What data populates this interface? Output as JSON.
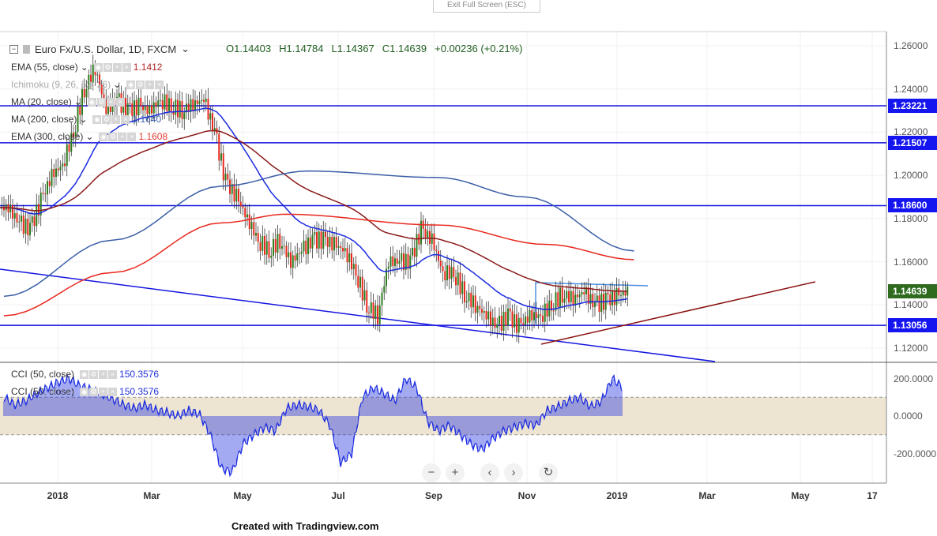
{
  "topbar": {
    "exit_label": "Exit Full Screen (ESC)"
  },
  "header": {
    "symbol": "Euro Fx/U.S. Dollar, 1D, FXCM",
    "open": "O1.14403",
    "high": "H1.14784",
    "low": "L1.14367",
    "close": "C1.14639",
    "change": "+0.00236 (+0.21%)"
  },
  "indicators": [
    {
      "label": "EMA (55, close)",
      "value": "1.1412",
      "color": "#b22222"
    },
    {
      "label": "Ichimoku (9, 26, 52, 26)",
      "value": "",
      "color": "#aaaaaa"
    },
    {
      "label": "MA (20, close)",
      "value": "",
      "color": "#1e3fd8"
    },
    {
      "label": "MA (200, close)",
      "value": "1.1640",
      "color": "#3b5fa8"
    },
    {
      "label": "EMA (300, close)",
      "value": "1.1608",
      "color": "#e53935"
    }
  ],
  "cci_legends": [
    {
      "label": "CCI (50, close)",
      "value": "150.3576"
    },
    {
      "label": "CCI (50, close)",
      "value": "150.3576"
    }
  ],
  "controls": {
    "zoom_out": "−",
    "zoom_in": "+",
    "back": "‹",
    "forward": "›",
    "reset": "↻"
  },
  "footer": {
    "credit": "Created with Tradingview.com"
  },
  "chart_data": {
    "type": "candlestick",
    "price_ticks": [
      "1.26000",
      "1.24000",
      "1.22000",
      "1.20000",
      "1.18000",
      "1.16000",
      "1.14000",
      "1.12000"
    ],
    "price_tick_values": [
      1.26,
      1.24,
      1.22,
      1.2,
      1.18,
      1.16,
      1.14,
      1.12
    ],
    "cci_ticks": [
      "200.0000",
      "0.0000",
      "-200.0000"
    ],
    "cci_tick_values": [
      200,
      0,
      -200
    ],
    "time_labels": [
      "2018",
      "Mar",
      "May",
      "Jul",
      "Sep",
      "Nov",
      "2019",
      "Mar",
      "May",
      "17"
    ],
    "horizontal_levels": [
      {
        "value": 1.23221,
        "label": "1.23221"
      },
      {
        "value": 1.21507,
        "label": "1.21507"
      },
      {
        "value": 1.186,
        "label": "1.18600"
      },
      {
        "value": 1.13056,
        "label": "1.13056"
      }
    ],
    "last_price": {
      "value": 1.14639,
      "label": "1.14639",
      "color": "#2e6b1f"
    },
    "weekly_closes": [
      1.185,
      1.178,
      1.175,
      1.188,
      1.2,
      1.205,
      1.22,
      1.24,
      1.25,
      1.23,
      1.235,
      1.23,
      1.232,
      1.23,
      1.235,
      1.232,
      1.23,
      1.233,
      1.235,
      1.22,
      1.197,
      1.19,
      1.18,
      1.17,
      1.165,
      1.17,
      1.16,
      1.165,
      1.17,
      1.17,
      1.168,
      1.165,
      1.155,
      1.14,
      1.135,
      1.16,
      1.16,
      1.16,
      1.175,
      1.17,
      1.155,
      1.155,
      1.145,
      1.14,
      1.135,
      1.13,
      1.135,
      1.13,
      1.135,
      1.135,
      1.14,
      1.145,
      1.143,
      1.146,
      1.14,
      1.142,
      1.144,
      1.14639
    ],
    "ma200": [
      [
        0,
        1.144
      ],
      [
        10,
        1.17
      ],
      [
        20,
        1.195
      ],
      [
        28,
        1.202
      ],
      [
        40,
        1.199
      ],
      [
        48,
        1.19
      ],
      [
        58,
        1.165
      ]
    ],
    "ema300": [
      [
        0,
        1.135
      ],
      [
        10,
        1.155
      ],
      [
        20,
        1.178
      ],
      [
        26,
        1.182
      ],
      [
        40,
        1.177
      ],
      [
        50,
        1.168
      ],
      [
        58,
        1.161
      ]
    ],
    "cci": [
      100,
      60,
      80,
      120,
      150,
      180,
      200,
      160,
      140,
      120,
      90,
      60,
      40,
      60,
      30,
      20,
      0,
      30,
      10,
      -100,
      -280,
      -300,
      -150,
      -100,
      -60,
      -80,
      40,
      60,
      50,
      30,
      -50,
      -250,
      -200,
      100,
      150,
      120,
      80,
      200,
      150,
      -30,
      -80,
      -50,
      -100,
      -150,
      -180,
      -120,
      -80,
      -60,
      -40,
      -50,
      30,
      50,
      80,
      100,
      50,
      80,
      200,
      150
    ]
  }
}
